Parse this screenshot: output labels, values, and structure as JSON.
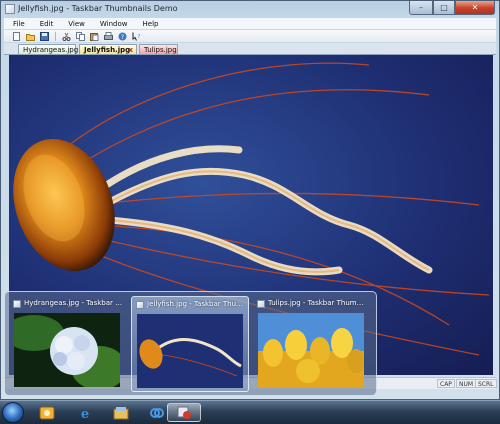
{
  "window": {
    "title": "Jellyfish.jpg - Taskbar Thumbnails Demo",
    "controls": {
      "minimize": "–",
      "maximize": "□",
      "close": "✕"
    }
  },
  "menubar": {
    "items": [
      "File",
      "Edit",
      "View",
      "Window",
      "Help"
    ]
  },
  "toolbar": {
    "icons": [
      "new-icon",
      "open-icon",
      "save-icon",
      "cut-icon",
      "copy-icon",
      "paste-icon",
      "print-icon",
      "help-icon",
      "context-help-icon"
    ]
  },
  "tabs": [
    {
      "label": "Hydrangeas.jpg",
      "color": "#d9ead0"
    },
    {
      "label": "Jellyfish.jpg",
      "color": "#f6e48f",
      "active": true,
      "close": "x"
    },
    {
      "label": "Tulips.jpg",
      "color": "#f2a2a8"
    }
  ],
  "statusbar": {
    "indicators": [
      "CAP",
      "NUM",
      "SCRL"
    ]
  },
  "thumbnails": [
    {
      "title": "Hydrangeas.jpg - Taskbar Thu...",
      "image": "hydrangeas"
    },
    {
      "title": "Jellyfish.jpg - Taskbar Thumbna...",
      "image": "jellyfish",
      "selected": true
    },
    {
      "title": "Tulips.jpg - Taskbar Thumbnail...",
      "image": "tulips"
    }
  ],
  "taskbar": {
    "items": [
      "start-orb-icon",
      "outlook-icon",
      "internet-explorer-icon",
      "file-explorer-icon",
      "media-player-icon",
      "app-icon"
    ]
  },
  "colors": {
    "accent": "#2f6fbf",
    "jellyfish_bg": "#1f2f74",
    "close_red": "#c7402a"
  }
}
